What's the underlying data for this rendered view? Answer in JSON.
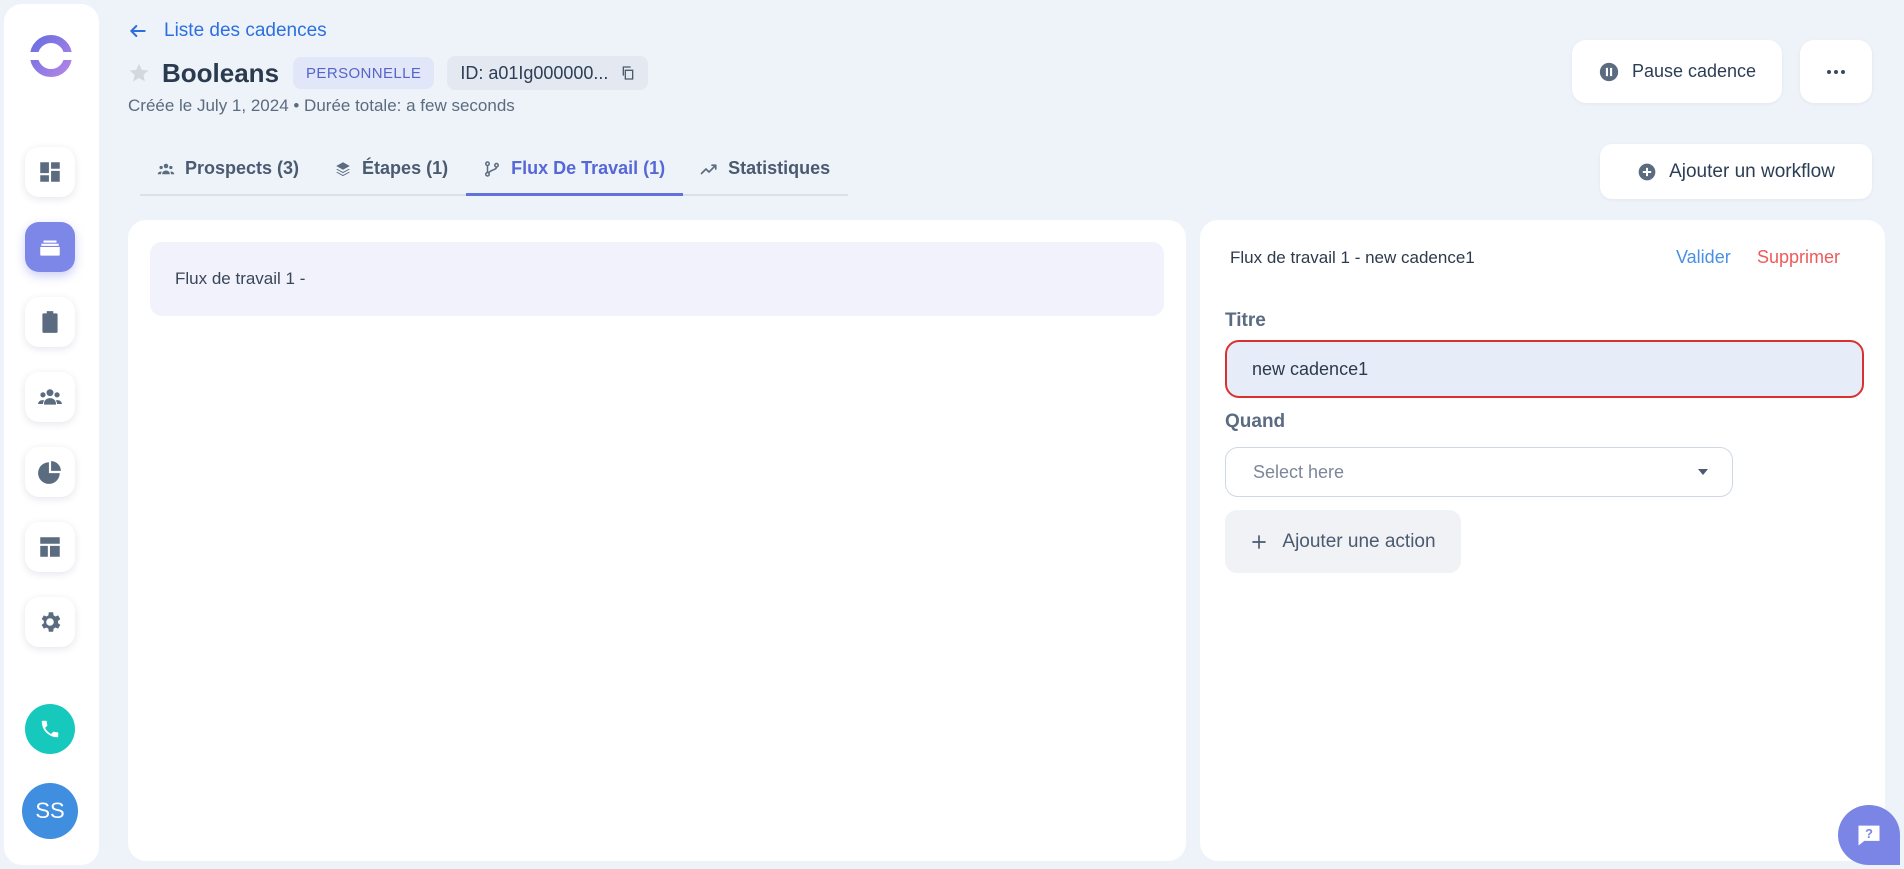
{
  "header": {
    "back_label": "Liste des cadences",
    "title": "Booleans",
    "badge": "PERSONNELLE",
    "id_label": "ID: a01Ig000000...",
    "subtitle": "Créée le July 1, 2024 • Durée totale: a few seconds",
    "pause_label": "Pause cadence"
  },
  "tabs": [
    {
      "label": "Prospects (3)",
      "icon": "users-icon"
    },
    {
      "label": "Étapes (1)",
      "icon": "layers-icon"
    },
    {
      "label": "Flux De Travail (1)",
      "icon": "branch-icon",
      "active": true
    },
    {
      "label": "Statistiques",
      "icon": "trend-icon"
    }
  ],
  "add_workflow_label": "Ajouter un workflow",
  "workflow_list": [
    {
      "label": "Flux de travail 1 -"
    }
  ],
  "editor": {
    "title": "Flux de travail 1 - new cadence1",
    "validate_label": "Valider",
    "delete_label": "Supprimer",
    "titre_label": "Titre",
    "titre_value": "new cadence1",
    "quand_label": "Quand",
    "quand_placeholder": "Select here",
    "add_action_label": "Ajouter une action"
  },
  "user": {
    "initials": "SS"
  },
  "colors": {
    "accent": "#7d87e8",
    "link": "#2d6fe0",
    "danger": "#ee5a5a",
    "phone": "#17c9bd",
    "avatar": "#3f8ee0"
  }
}
